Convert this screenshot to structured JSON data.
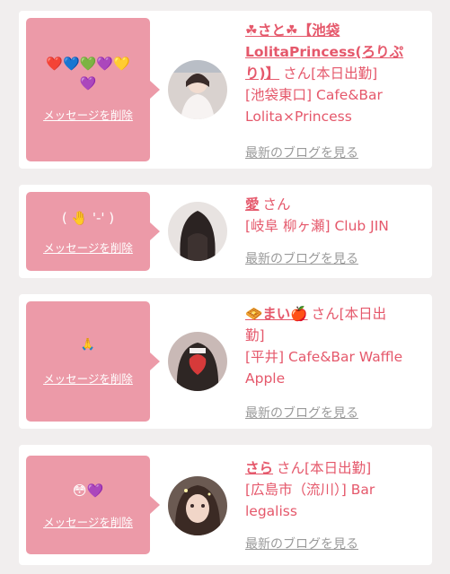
{
  "cards": [
    {
      "message": "❤️💙💚💜💛💜",
      "message_line1": "❤️💙💚💜💛",
      "message_line2": "💜",
      "delete_label": "メッセージを削除",
      "name_line1": "☘さと☘【池袋",
      "name_line2": "LolitaPrincess(ろりぷ",
      "name_line3": "り)】",
      "san": "さん",
      "status": "[本日出勤]",
      "location_line1": "[池袋東口] Cafe&Bar",
      "location_line2": "Lolita×Princess",
      "blog_label": "最新のブログを見る"
    },
    {
      "message": "( 🤚 '-' )",
      "delete_label": "メッセージを削除",
      "name": "愛",
      "san": "さん",
      "location": "[岐阜 柳ヶ瀬] Club JIN",
      "blog_label": "最新のブログを見る"
    },
    {
      "message": "🙏",
      "delete_label": "メッセージを削除",
      "name": "🧇まい🍎",
      "san": "さん[本日出",
      "status_cont": "勤]",
      "location_line1": "[平井] Cafe&Bar Waffle",
      "location_line2": "Apple",
      "blog_label": "最新のブログを見る"
    },
    {
      "message": "😳💜",
      "delete_label": "メッセージを削除",
      "name": "さら",
      "san": "さん[本日出勤]",
      "location_line1": "[広島市（流川）] Bar",
      "location_line2": "legaliss",
      "blog_label": "最新のブログを見る"
    }
  ],
  "colors": {
    "background": "#f1eeee",
    "card": "#ffffff",
    "bubble": "#ec9aa8",
    "accent": "#e5586b",
    "link_gray": "#9a9a9a"
  }
}
